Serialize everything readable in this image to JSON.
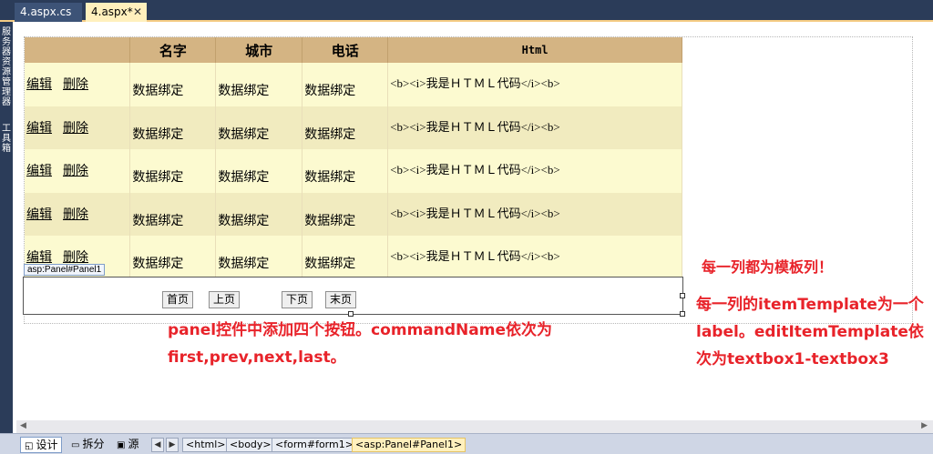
{
  "tabs": [
    {
      "label": "4.aspx.cs",
      "active": false
    },
    {
      "label": "4.aspx*",
      "active": true,
      "close": "✕"
    }
  ],
  "toolbox": {
    "labels": [
      "服务器资源管理器",
      "工具箱"
    ]
  },
  "grid": {
    "headers": [
      "",
      "名字",
      "城市",
      "电话",
      "Html"
    ],
    "rows": [
      {
        "edit": "编辑",
        "delete": "删除",
        "name": "数据绑定",
        "city": "数据绑定",
        "phone": "数据绑定",
        "html": "<b><i>我是ＨＴＭＬ代码</i><b>"
      },
      {
        "edit": "编辑",
        "delete": "删除",
        "name": "数据绑定",
        "city": "数据绑定",
        "phone": "数据绑定",
        "html": "<b><i>我是ＨＴＭＬ代码</i><b>"
      },
      {
        "edit": "编辑",
        "delete": "删除",
        "name": "数据绑定",
        "city": "数据绑定",
        "phone": "数据绑定",
        "html": "<b><i>我是ＨＴＭＬ代码</i><b>"
      },
      {
        "edit": "编辑",
        "delete": "删除",
        "name": "数据绑定",
        "city": "数据绑定",
        "phone": "数据绑定",
        "html": "<b><i>我是ＨＴＭＬ代码</i><b>"
      },
      {
        "edit": "编辑",
        "delete": "删除",
        "name": "数据绑定",
        "city": "数据绑定",
        "phone": "数据绑定",
        "html": "<b><i>我是ＨＴＭＬ代码</i><b>"
      }
    ]
  },
  "panel": {
    "tag": "asp:Panel#Panel1",
    "buttons": {
      "first": "首页",
      "prev": "上页",
      "next": "下页",
      "last": "末页"
    }
  },
  "notes": {
    "template_columns": "每一列都为模板列！",
    "item_template": "每一列的itemTemplate为一个label。editItemTemplate依次为textbox1-textbox3",
    "panel_buttons": "panel控件中添加四个按钮。commandName依次为first,prev,next,last。"
  },
  "viewbar": {
    "design": "设计",
    "split": "拆分",
    "source": "源",
    "breadcrumbs": [
      "<html>",
      "<body>",
      "<form#form1>",
      "<asp:Panel#Panel1>"
    ]
  },
  "colors": {
    "header_bg": "#d4b483",
    "row_odd": "#fcfad0",
    "row_even": "#f1ebbf",
    "annotation": "#e8232a",
    "chrome_dark": "#2b3c59"
  }
}
